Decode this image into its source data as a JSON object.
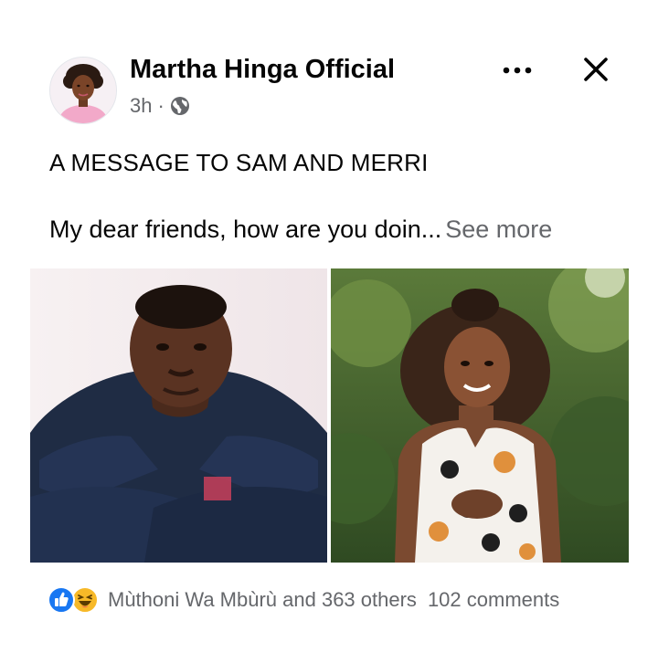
{
  "post": {
    "author": "Martha Hinga Official",
    "time": "3h",
    "separator": "·",
    "title": "A MESSAGE TO SAM AND MERRI",
    "excerpt": "My dear friends, how are you doin...",
    "see_more": "See more",
    "icons": {
      "audience": "globe-icon",
      "more": "ellipsis-icon",
      "close": "close-icon"
    }
  },
  "photos": [
    {
      "subject": "man",
      "alt": ""
    },
    {
      "subject": "woman",
      "alt": ""
    }
  ],
  "reactions": {
    "types": [
      "like-icon",
      "haha-icon"
    ],
    "summary": "Mùthoni Wa Mbùrù and 363 others",
    "comments": "102 comments"
  },
  "colors": {
    "text": "#050505",
    "secondary": "#65676b",
    "like": "#1877f2",
    "haha": "#f7b928"
  }
}
